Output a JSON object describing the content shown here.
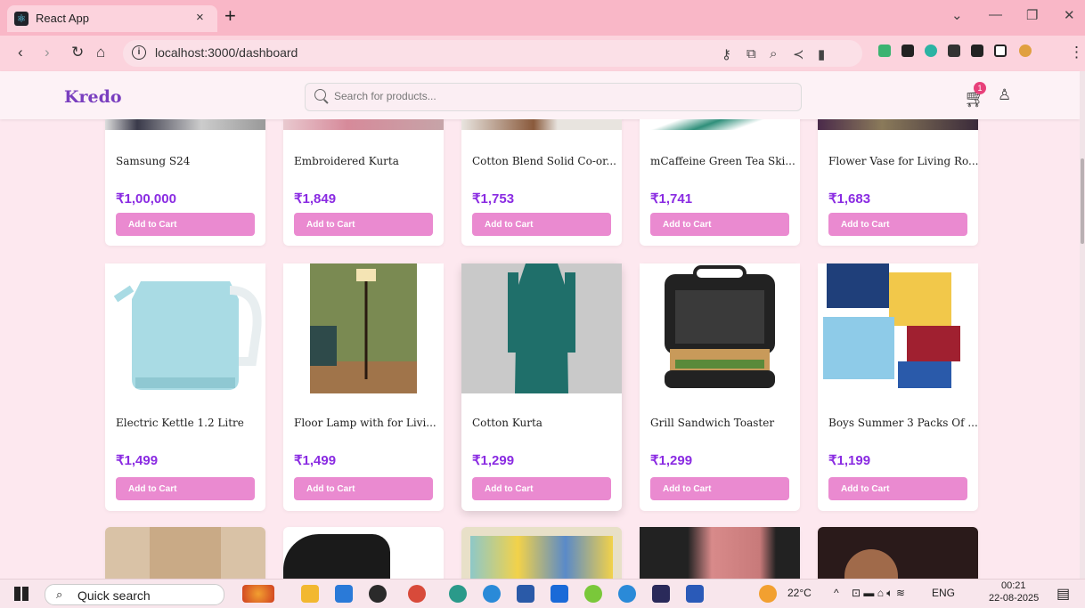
{
  "browser": {
    "tab_title": "React App",
    "url": "localhost:3000/dashboard",
    "close_glyph": "×",
    "new_tab_glyph": "+"
  },
  "app": {
    "logo": "Kredo",
    "search_placeholder": "Search for products...",
    "cart_count": "1"
  },
  "products": [
    {
      "name": "Samsung S24",
      "price": "₹1,00,000",
      "button": "Add to Cart"
    },
    {
      "name": "Embroidered Kurta",
      "price": "₹1,849",
      "button": "Add to Cart"
    },
    {
      "name": "Cotton Blend Solid Co-or...",
      "price": "₹1,753",
      "button": "Add to Cart"
    },
    {
      "name": "mCaffeine Green Tea Ski...",
      "price": "₹1,741",
      "button": "Add to Cart"
    },
    {
      "name": "Flower Vase for Living Ro...",
      "price": "₹1,683",
      "button": "Add to Cart"
    },
    {
      "name": "Electric Kettle 1.2 Litre",
      "price": "₹1,499",
      "button": "Add to Cart"
    },
    {
      "name": "Floor Lamp with for Livi...",
      "price": "₹1,499",
      "button": "Add to Cart"
    },
    {
      "name": "Cotton Kurta",
      "price": "₹1,299",
      "button": "Add to Cart"
    },
    {
      "name": "Grill Sandwich Toaster",
      "price": "₹1,299",
      "button": "Add to Cart"
    },
    {
      "name": "Boys Summer 3 Packs Of ...",
      "price": "₹1,199",
      "button": "Add to Cart"
    }
  ],
  "taskbar": {
    "search": "Quick search",
    "temperature": "22°C",
    "language": "ENG",
    "time": "00:21",
    "date": "22-08-2025"
  },
  "colors": {
    "accent": "#ea8ad0",
    "price": "#8a2be2",
    "logo": "#7a3fbf",
    "tabbar": "#f9b7c7"
  }
}
